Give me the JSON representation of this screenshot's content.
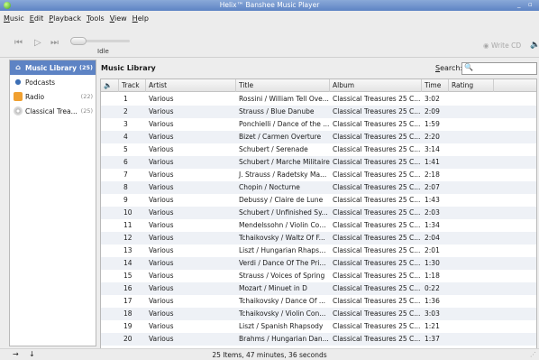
{
  "window": {
    "title": "Helix™ Banshee Music Player",
    "minimize_glyph": "_",
    "close_glyph": "▫"
  },
  "menu": [
    "Music",
    "Edit",
    "Playback",
    "Tools",
    "View",
    "Help"
  ],
  "toolbar": {
    "prev_icon": "previous-icon",
    "play_icon": "play-icon",
    "next_icon": "next-icon",
    "status": "Idle",
    "write_cd": "Write CD",
    "volume_icon": "volume-icon"
  },
  "sidebar": {
    "items": [
      {
        "label": "Music Library",
        "count": "(25)",
        "icon": "library-icon",
        "selected": true
      },
      {
        "label": "Podcasts",
        "count": "",
        "icon": "podcast-icon",
        "selected": false
      },
      {
        "label": "Radio",
        "count": "(22)",
        "icon": "radio-icon",
        "selected": false
      },
      {
        "label": "Classical Trea...",
        "count": "(25)",
        "icon": "cd-icon",
        "selected": false
      }
    ]
  },
  "main": {
    "title": "Music Library",
    "search_label": "Search:",
    "search_value": ""
  },
  "table": {
    "headers": [
      "Track",
      "Artist",
      "Title",
      "Album",
      "Time",
      "Rating"
    ],
    "rows": [
      {
        "track": "1",
        "artist": "Various",
        "title": "Rossini / William Tell Ove...",
        "album": "Classical Treasures 25 C...",
        "time": "3:02"
      },
      {
        "track": "2",
        "artist": "Various",
        "title": "Strauss / Blue Danube",
        "album": "Classical Treasures 25 C...",
        "time": "2:09"
      },
      {
        "track": "3",
        "artist": "Various",
        "title": "Ponchielli / Dance of the ...",
        "album": "Classical Treasures 25 C...",
        "time": "1:59"
      },
      {
        "track": "4",
        "artist": "Various",
        "title": "Bizet / Carmen Overture",
        "album": "Classical Treasures 25 C...",
        "time": "2:20"
      },
      {
        "track": "5",
        "artist": "Various",
        "title": "Schubert / Serenade",
        "album": "Classical Treasures 25 C...",
        "time": "3:14"
      },
      {
        "track": "6",
        "artist": "Various",
        "title": "Schubert / Marche Militaire",
        "album": "Classical Treasures 25 C...",
        "time": "1:41"
      },
      {
        "track": "7",
        "artist": "Various",
        "title": "J. Strauss / Radetsky Ma...",
        "album": "Classical Treasures 25 C...",
        "time": "2:18"
      },
      {
        "track": "8",
        "artist": "Various",
        "title": "Chopin / Nocturne",
        "album": "Classical Treasures 25 C...",
        "time": "2:07"
      },
      {
        "track": "9",
        "artist": "Various",
        "title": "Debussy / Claire de Lune",
        "album": "Classical Treasures 25 C...",
        "time": "1:43"
      },
      {
        "track": "10",
        "artist": "Various",
        "title": "Schubert / Unfinished Sy...",
        "album": "Classical Treasures 25 C...",
        "time": "2:03"
      },
      {
        "track": "11",
        "artist": "Various",
        "title": "Mendelssohn / Violin Con...",
        "album": "Classical Treasures 25 C...",
        "time": "1:34"
      },
      {
        "track": "12",
        "artist": "Various",
        "title": "Tchaikovsky / Waltz Of F...",
        "album": "Classical Treasures 25 C...",
        "time": "2:04"
      },
      {
        "track": "13",
        "artist": "Various",
        "title": "Liszt / Hungarian Rhapsody",
        "album": "Classical Treasures 25 C...",
        "time": "2:01"
      },
      {
        "track": "14",
        "artist": "Various",
        "title": "Verdi / Dance Of The Pri...",
        "album": "Classical Treasures 25 C...",
        "time": "1:30"
      },
      {
        "track": "15",
        "artist": "Various",
        "title": "Strauss / Voices of Spring",
        "album": "Classical Treasures 25 C...",
        "time": "1:18"
      },
      {
        "track": "16",
        "artist": "Various",
        "title": "Mozart / Minuet in D",
        "album": "Classical Treasures 25 C...",
        "time": "0:22"
      },
      {
        "track": "17",
        "artist": "Various",
        "title": "Tchaikovsky / Dance Of ...",
        "album": "Classical Treasures 25 C...",
        "time": "1:36"
      },
      {
        "track": "18",
        "artist": "Various",
        "title": "Tchaikovsky / Violin Con...",
        "album": "Classical Treasures 25 C...",
        "time": "3:03"
      },
      {
        "track": "19",
        "artist": "Various",
        "title": "Liszt / Spanish Rhapsody",
        "album": "Classical Treasures 25 C...",
        "time": "1:21"
      },
      {
        "track": "20",
        "artist": "Various",
        "title": "Brahms / Hungarian Dan...",
        "album": "Classical Treasures 25 C...",
        "time": "1:37"
      }
    ]
  },
  "status": {
    "summary": "25 Items, 47 minutes, 36 seconds",
    "shuffle_icon": "shuffle-icon",
    "repeat_icon": "repeat-icon"
  },
  "colors": {
    "titlebar": "#5d83c4",
    "selection": "#5d83c4",
    "row_alt": "#eef1f6"
  }
}
